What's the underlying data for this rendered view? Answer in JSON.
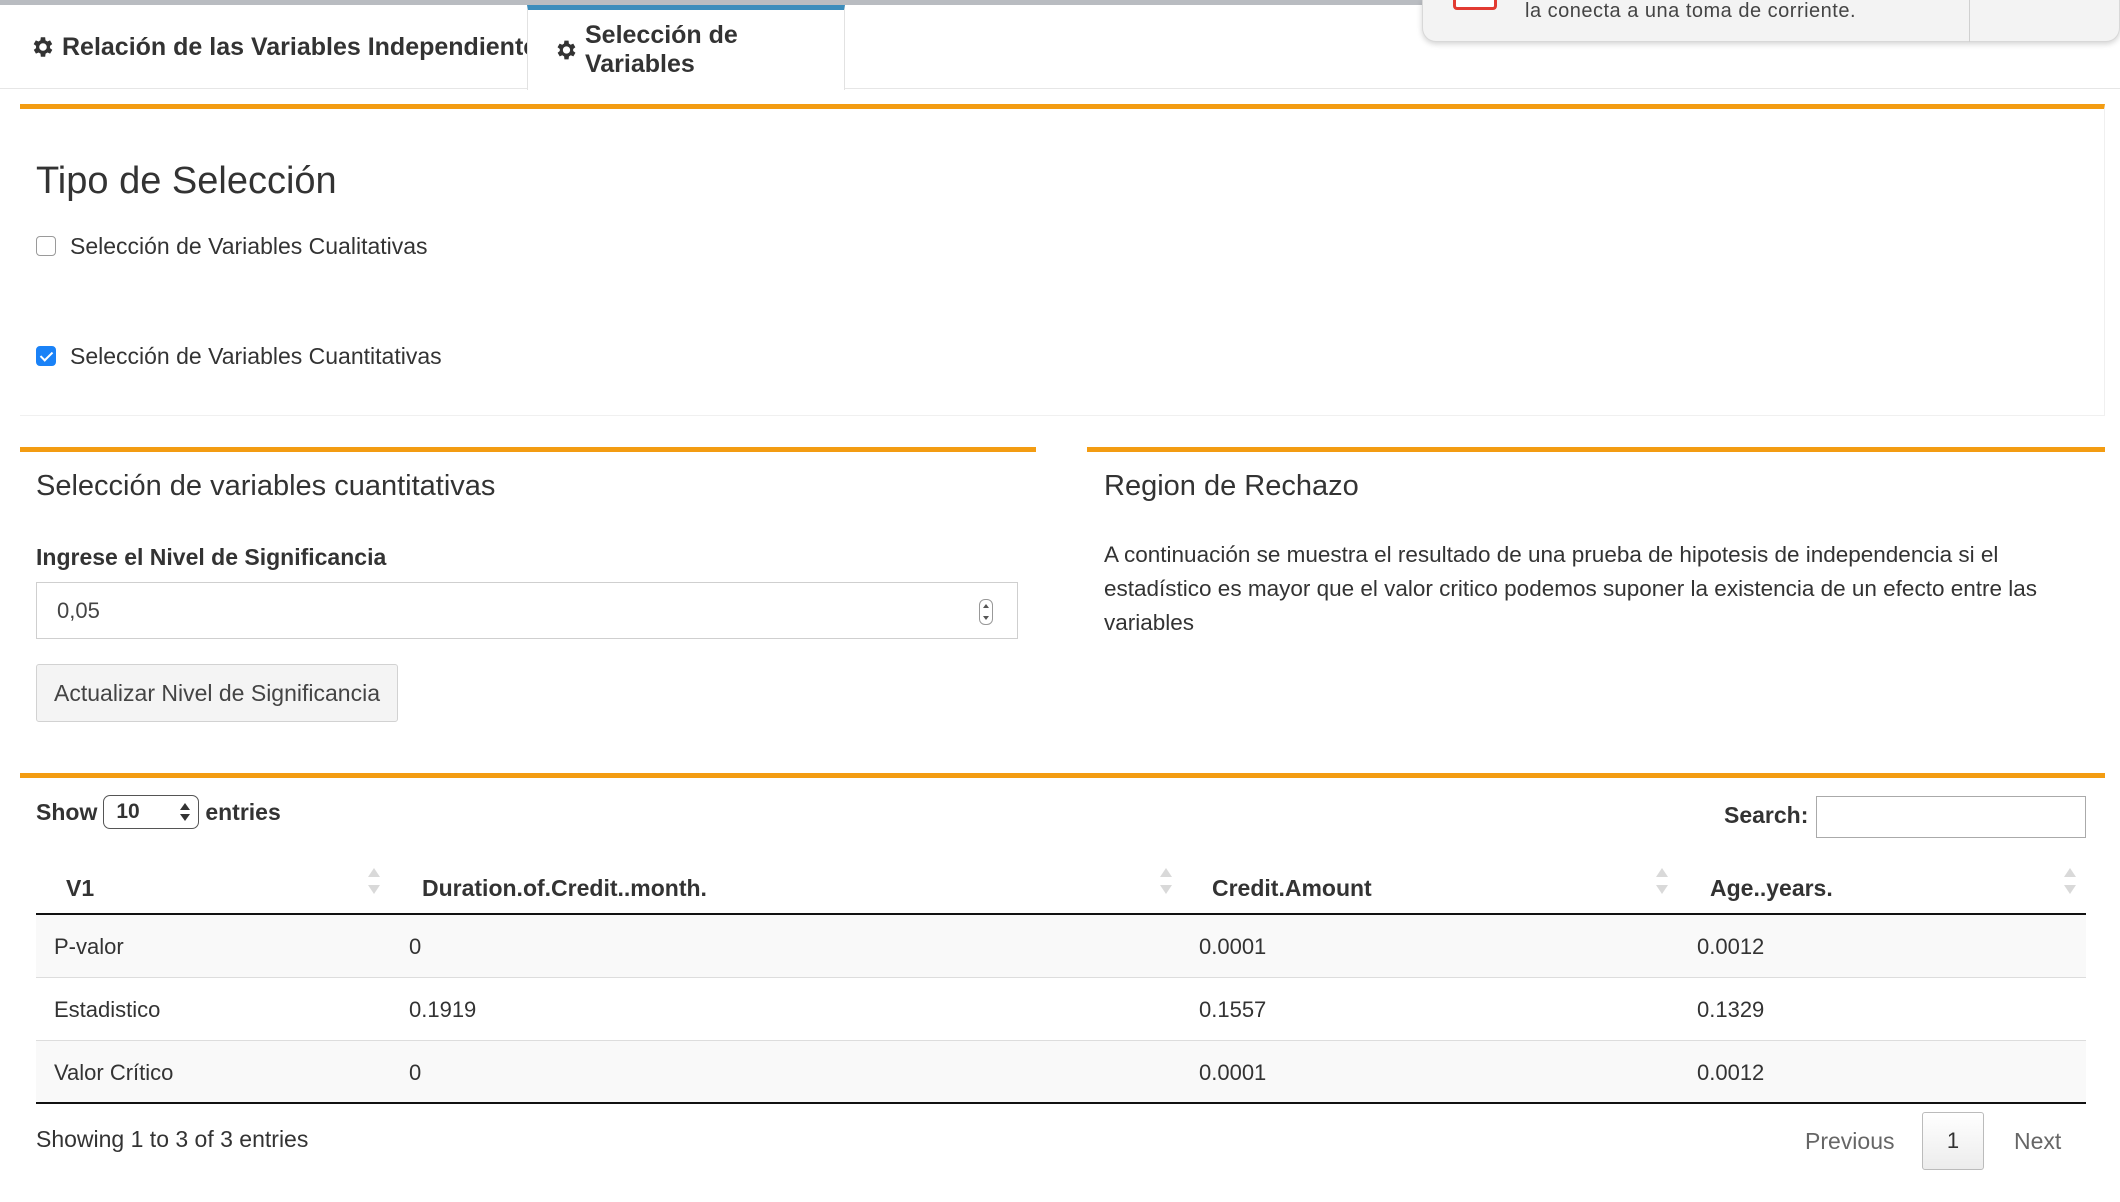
{
  "tabs": [
    {
      "label": "Relación de las Variables Independientes",
      "icon": "gear-icon"
    },
    {
      "label": "Selección de Variables",
      "icon": "gear-icon",
      "active": true
    }
  ],
  "notification": {
    "text": "la conecta a una toma de corriente."
  },
  "selection_type": {
    "title": "Tipo de Selección",
    "options": [
      {
        "label": "Selección de Variables Cualitativas",
        "checked": false
      },
      {
        "label": "Selección de Variables Cuantitativas",
        "checked": true
      }
    ]
  },
  "quant_panel": {
    "title": "Selección de variables cuantitativas",
    "input_label": "Ingrese el Nivel de Significancia",
    "input_value": "0,05",
    "button_label": "Actualizar Nivel de Significancia"
  },
  "rejection_panel": {
    "title": "Region de Rechazo",
    "description": "A continuación se muestra el resultado de una prueba de hipotesis de independencia si el estadístico es mayor que el valor critico podemos suponer la existencia de un efecto entre las variables"
  },
  "table": {
    "show_label": "Show",
    "entries_value": "10",
    "entries_label": "entries",
    "search_label": "Search:",
    "columns": [
      "V1",
      "Duration.of.Credit..month.",
      "Credit.Amount",
      "Age..years."
    ],
    "rows": [
      [
        "P-valor",
        "0",
        "0.0001",
        "0.0012"
      ],
      [
        "Estadistico",
        "0.1919",
        "0.1557",
        "0.1329"
      ],
      [
        "Valor Crítico",
        "0",
        "0.0001",
        "0.0012"
      ]
    ],
    "info": "Showing 1 to 3 of 3 entries",
    "pagination": {
      "previous": "Previous",
      "current": "1",
      "next": "Next"
    }
  },
  "colors": {
    "accent": "#f39c12",
    "active_tab": "#3c8dbc",
    "checkbox": "#1a82f7"
  }
}
